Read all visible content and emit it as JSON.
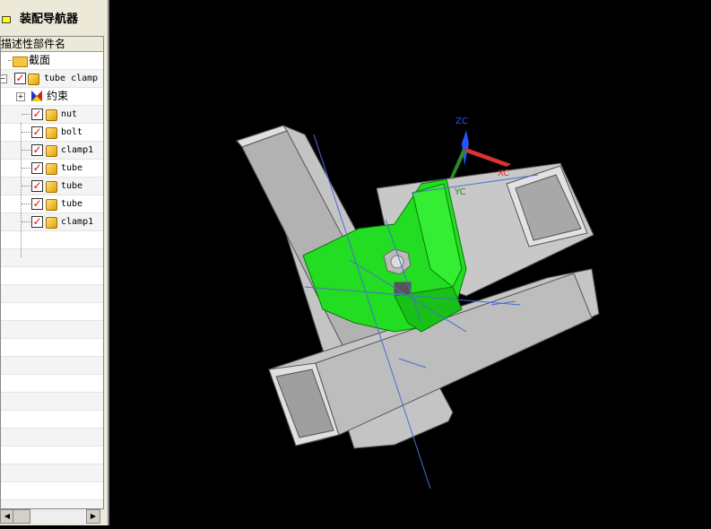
{
  "navigator": {
    "title": "装配导航器",
    "column_header": "描述性部件名",
    "items": [
      {
        "label": "截面",
        "type": "folder"
      },
      {
        "label": "tube clamp",
        "type": "assembly",
        "checked": true
      },
      {
        "label": "约束",
        "type": "constraints"
      },
      {
        "label": "nut",
        "type": "part",
        "checked": true
      },
      {
        "label": "bolt",
        "type": "part",
        "checked": true
      },
      {
        "label": "clamp1",
        "type": "part",
        "checked": true
      },
      {
        "label": "tube",
        "type": "part",
        "checked": true
      },
      {
        "label": "tube",
        "type": "part",
        "checked": true
      },
      {
        "label": "tube",
        "type": "part",
        "checked": true
      },
      {
        "label": "clamp1",
        "type": "part",
        "checked": true
      }
    ]
  },
  "viewport": {
    "background": "#000000",
    "part_color": "#c8c8c8",
    "clamp_color": "#22dd22",
    "triad": {
      "x": "XC",
      "y": "YC",
      "z": "ZC"
    }
  }
}
